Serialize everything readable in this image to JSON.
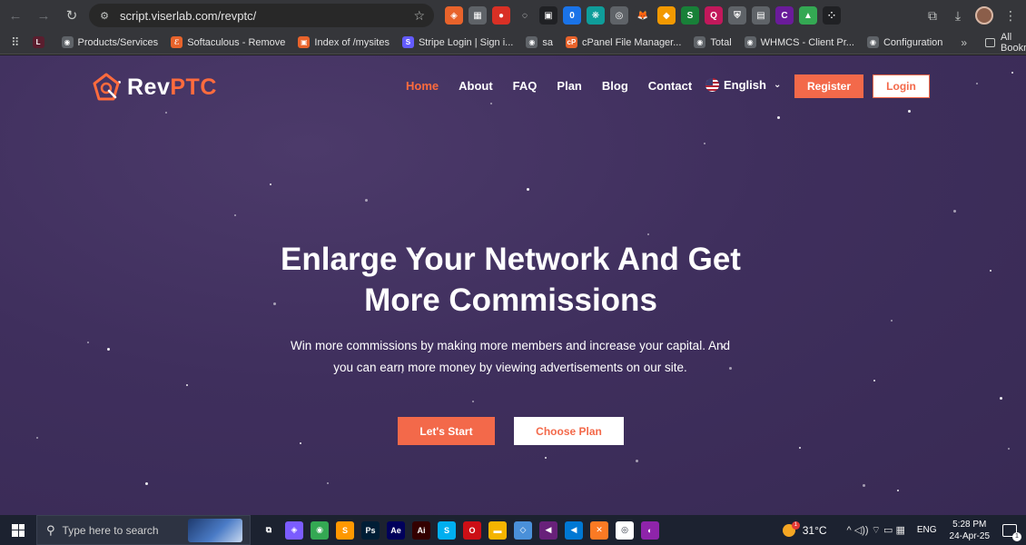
{
  "browser": {
    "url": "script.viserlab.com/revptc/",
    "back_icon": "←",
    "forward_icon": "→",
    "reload_icon": "↻",
    "site_info_icon": "⚙",
    "bookmark_star_icon": "☆",
    "extensions": [
      {
        "name": "ext-1",
        "glyph": "◈",
        "color": "#e8632b"
      },
      {
        "name": "ext-2",
        "glyph": "▦",
        "color": "#5f6368"
      },
      {
        "name": "ext-3",
        "glyph": "●",
        "color": "#d93025"
      },
      {
        "name": "ext-4",
        "glyph": "◌",
        "color": "#35363a"
      },
      {
        "name": "ext-5",
        "glyph": "▣",
        "color": "#202124"
      },
      {
        "name": "ext-6",
        "glyph": "0",
        "color": "#1a73e8"
      },
      {
        "name": "ext-7",
        "glyph": "❋",
        "color": "#0f9d9a"
      },
      {
        "name": "ext-8",
        "glyph": "◎",
        "color": "#5f6368"
      },
      {
        "name": "ext-9",
        "glyph": "🦊",
        "color": "#35363a"
      },
      {
        "name": "ext-10",
        "glyph": "◆",
        "color": "#f29900"
      },
      {
        "name": "ext-11",
        "glyph": "S",
        "color": "#188038"
      },
      {
        "name": "ext-12",
        "glyph": "Q",
        "color": "#c2185b"
      },
      {
        "name": "ext-13",
        "glyph": "⛨",
        "color": "#5f6368"
      },
      {
        "name": "ext-14",
        "glyph": "▤",
        "color": "#5f6368"
      },
      {
        "name": "ext-15",
        "glyph": "C",
        "color": "#6a1b9a"
      },
      {
        "name": "ext-16",
        "glyph": "▲",
        "color": "#34a853"
      },
      {
        "name": "ext-17",
        "glyph": "⁘",
        "color": "#202124"
      }
    ],
    "right_icons": {
      "extensions": "⧉",
      "download": "⤓",
      "menu": "⋮"
    }
  },
  "bookmarks": {
    "apps_icon": "⠿",
    "items": [
      {
        "label": "",
        "fav": "L",
        "color": "#5a1e2e"
      },
      {
        "label": "Products/Services",
        "fav": "◉",
        "color": "#5f6368"
      },
      {
        "label": "Softaculous - Remove",
        "fav": "ℰ",
        "color": "#e8632b"
      },
      {
        "label": "Index of /mysites",
        "fav": "▣",
        "color": "#e8632b"
      },
      {
        "label": "Stripe Login | Sign i...",
        "fav": "S",
        "color": "#635bff"
      },
      {
        "label": "sa",
        "fav": "◉",
        "color": "#5f6368"
      },
      {
        "label": "cPanel File Manager...",
        "fav": "cP",
        "color": "#e8632b"
      },
      {
        "label": "Total",
        "fav": "◉",
        "color": "#5f6368"
      },
      {
        "label": "WHMCS - Client Pr...",
        "fav": "◉",
        "color": "#5f6368"
      },
      {
        "label": "Configuration",
        "fav": "◉",
        "color": "#5f6368"
      }
    ],
    "more": "»",
    "all_bookmarks": "All Bookmarks"
  },
  "site": {
    "logo_prefix": "Rev",
    "logo_suffix": "PTC",
    "nav": [
      {
        "label": "Home",
        "active": true
      },
      {
        "label": "About",
        "active": false
      },
      {
        "label": "FAQ",
        "active": false
      },
      {
        "label": "Plan",
        "active": false
      },
      {
        "label": "Blog",
        "active": false
      },
      {
        "label": "Contact",
        "active": false
      }
    ],
    "language": "English",
    "register_label": "Register",
    "login_label": "Login",
    "hero_title_line1": "Enlarge Your Network And Get",
    "hero_title_line2": "More Commissions",
    "hero_sub_line1": "Win more commissions by making more members and increase your capital. And",
    "hero_sub_line2": "you can earn more money by viewing advertisements on our site.",
    "start_label": "Let's Start",
    "plan_label": "Choose Plan",
    "accent_color": "#f3694a"
  },
  "taskbar": {
    "search_placeholder": "Type here to search",
    "apps": [
      {
        "name": "task-view",
        "glyph": "⧉",
        "color": "#1c2230"
      },
      {
        "name": "copilot",
        "glyph": "◈",
        "color": "#7b5cff"
      },
      {
        "name": "chrome",
        "glyph": "◉",
        "color": "#34a853"
      },
      {
        "name": "sublime",
        "glyph": "S",
        "color": "#ff9800"
      },
      {
        "name": "photoshop",
        "glyph": "Ps",
        "color": "#001e36"
      },
      {
        "name": "after-effects",
        "glyph": "Ae",
        "color": "#00005b"
      },
      {
        "name": "illustrator",
        "glyph": "Ai",
        "color": "#330000"
      },
      {
        "name": "skype",
        "glyph": "S",
        "color": "#00aff0"
      },
      {
        "name": "opera",
        "glyph": "O",
        "color": "#cc0f16"
      },
      {
        "name": "file-explorer",
        "glyph": "▬",
        "color": "#f5b400"
      },
      {
        "name": "notepad",
        "glyph": "◇",
        "color": "#4a90d9"
      },
      {
        "name": "visual-studio",
        "glyph": "◀",
        "color": "#68217a"
      },
      {
        "name": "vscode",
        "glyph": "◀",
        "color": "#0078d4"
      },
      {
        "name": "xampp",
        "glyph": "✕",
        "color": "#fb7a24"
      },
      {
        "name": "app-ring",
        "glyph": "◎",
        "color": "#ffffff"
      },
      {
        "name": "app-circle",
        "glyph": "◐",
        "color": "#8e24aa"
      }
    ],
    "weather_temp": "31°C",
    "weather_badge": "1",
    "tray_icons": "^  ◁))  ⌔  ▭  ▦",
    "language": "ENG",
    "time": "5:28 PM",
    "date": "24-Apr-25",
    "notification_count": "1"
  }
}
